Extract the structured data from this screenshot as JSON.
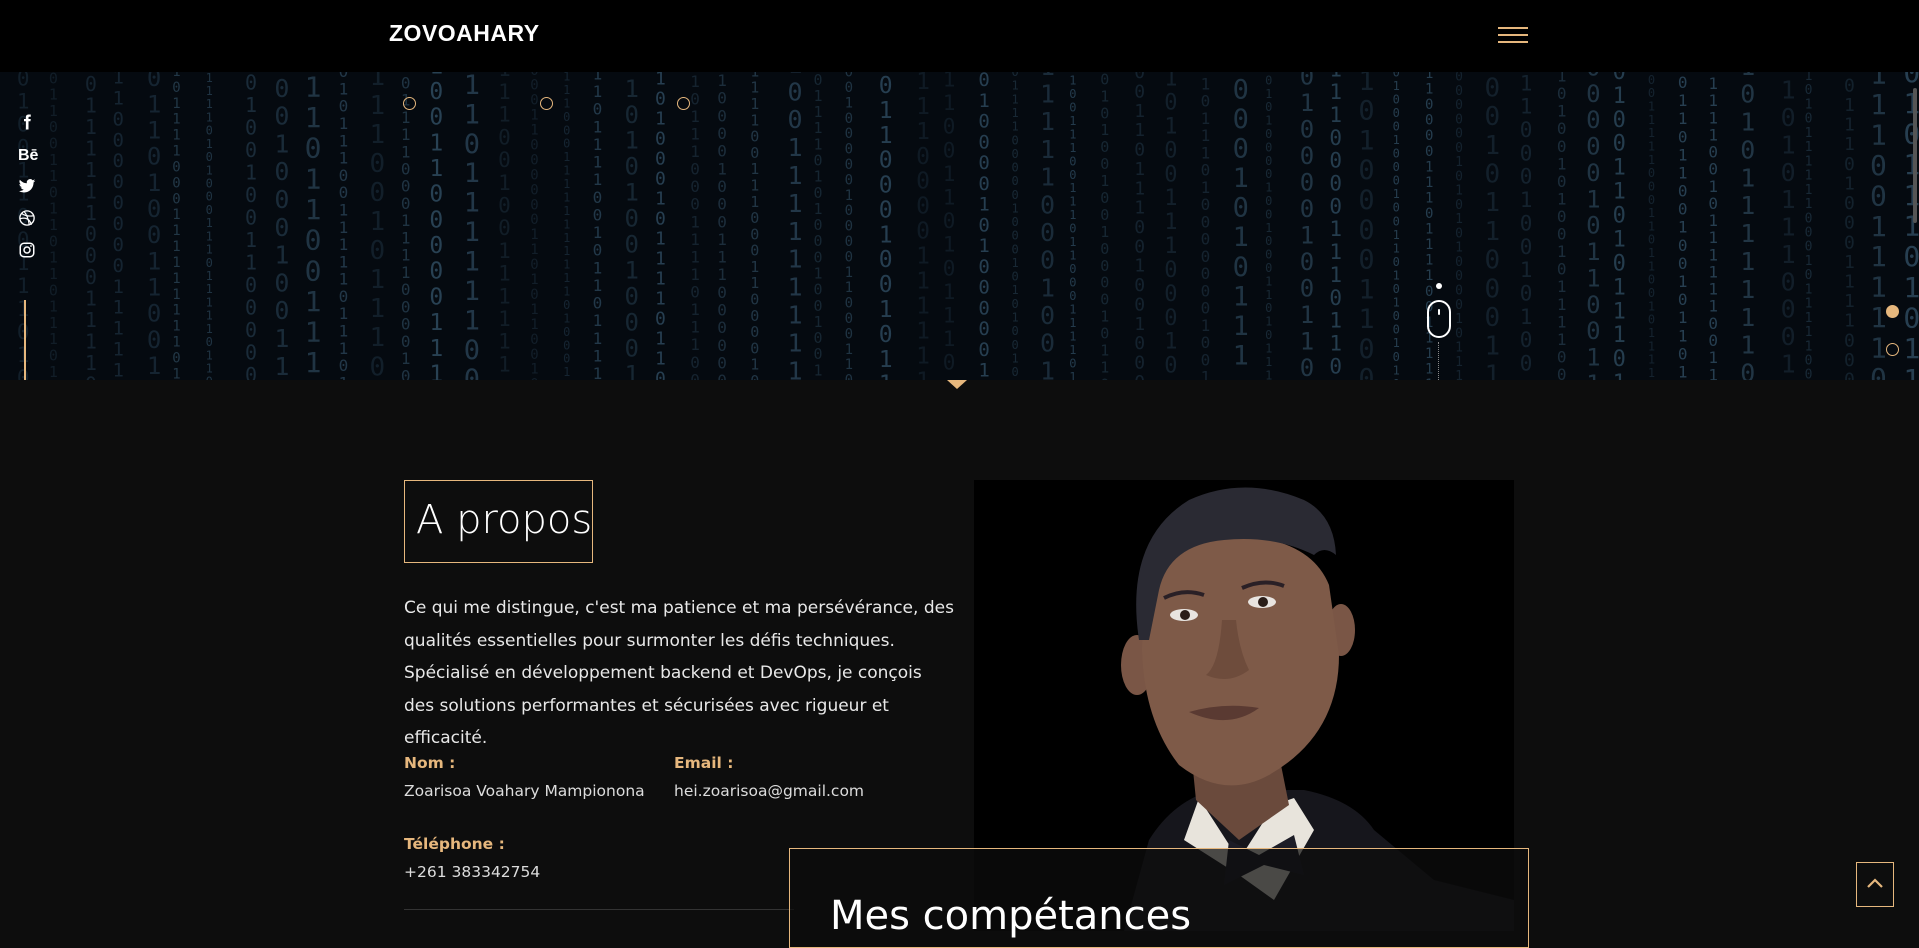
{
  "header": {
    "logo": "ZOVOAHARY",
    "menu_icon": "hamburger-icon"
  },
  "social": [
    {
      "name": "facebook",
      "glyph": "f"
    },
    {
      "name": "behance",
      "glyph": "Bē"
    },
    {
      "name": "twitter",
      "glyph": ""
    },
    {
      "name": "dribbble",
      "glyph": ""
    },
    {
      "name": "instagram",
      "glyph": ""
    }
  ],
  "hero": {
    "slides": 2,
    "active_slide": 1
  },
  "about": {
    "title": "A propos",
    "text": "Ce qui me distingue, c'est ma patience et ma persévérance, des qualités essentielles pour surmonter les défis techniques. Spécialisé en développement backend et DevOps, je conçois des solutions performantes et sécurisées avec rigueur et efficacité.",
    "nom_label": "Nom :",
    "nom_value": "Zoarisoa Voahary Mampionona",
    "email_label": "Email :",
    "email_value": "hei.zoarisoa@gmail.com",
    "tel_label": "Téléphone :",
    "tel_value": "+261 383342754"
  },
  "skills": {
    "title": "Mes compétances"
  },
  "colors": {
    "accent": "#e6b77d",
    "background": "#0d0d0d",
    "header": "#000000"
  }
}
